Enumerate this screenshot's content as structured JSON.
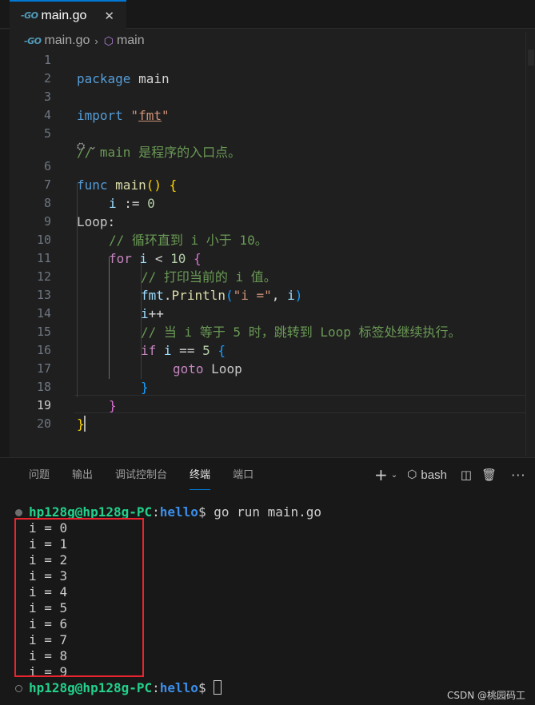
{
  "tab": {
    "icon_text": "-GO",
    "label": "main.go",
    "close": "✕"
  },
  "breadcrumb": {
    "file_icon_text": "-GO",
    "file": "main.go",
    "separator": "›",
    "symbol": "main"
  },
  "editor": {
    "current_line": 19,
    "line_numbers": [
      "1",
      "2",
      "3",
      "4",
      "5",
      "6",
      "7",
      "8",
      "9",
      "10",
      "11",
      "12",
      "13",
      "14",
      "15",
      "16",
      "17",
      "18",
      "19",
      "20"
    ],
    "code": {
      "l1": [
        "package",
        " main"
      ],
      "l3": [
        "import",
        " \"",
        "fmt",
        "\""
      ],
      "l5": "// main 是程序的入口点。",
      "codelens": "⛭ ⌄",
      "l6": [
        "func",
        " ",
        "main",
        "()",
        " ",
        "{"
      ],
      "l7": [
        "i",
        " := ",
        "0"
      ],
      "l8": [
        "Loop",
        ":"
      ],
      "l9": "// 循环直到 i 小于 10。",
      "l10": [
        "for",
        " ",
        "i",
        " < ",
        "10",
        " ",
        "{"
      ],
      "l11": "// 打印当前的 i 值。",
      "l12": [
        "fmt",
        ".",
        "Println",
        "(",
        "\"i =\"",
        ", ",
        "i",
        ")"
      ],
      "l13": [
        "i",
        "++"
      ],
      "l14": "// 当 i 等于 5 时，跳转到 Loop 标签处继续执行。",
      "l15": [
        "if",
        " ",
        "i",
        " == ",
        "5",
        " ",
        "{"
      ],
      "l16": [
        "goto",
        " ",
        "Loop"
      ],
      "l17": "}",
      "l18": "}",
      "l19": "}"
    }
  },
  "panel": {
    "tabs": [
      "问题",
      "输出",
      "调试控制台",
      "终端",
      "端口"
    ],
    "active_tab": "终端",
    "tools": {
      "add": "+",
      "dropdown": "⌄",
      "shell_icon": "⬡",
      "shell": "bash",
      "split": "◫",
      "trash": "🗑",
      "more": "···"
    }
  },
  "terminal": {
    "user": "hp128g@hp128g-PC",
    "colon": ":",
    "dir": "hello",
    "prompt_symbol": "$ ",
    "command": "go run main.go",
    "output": [
      "i = 0",
      "i = 1",
      "i = 2",
      "i = 3",
      "i = 4",
      "i = 5",
      "i = 6",
      "i = 7",
      "i = 8",
      "i = 9"
    ]
  },
  "watermark": "CSDN @桃园码工",
  "colors": {
    "accent": "#0078d4",
    "highlight_box": "#e8242f",
    "terminal_user": "#23d18b",
    "terminal_dir": "#3b8eea"
  }
}
